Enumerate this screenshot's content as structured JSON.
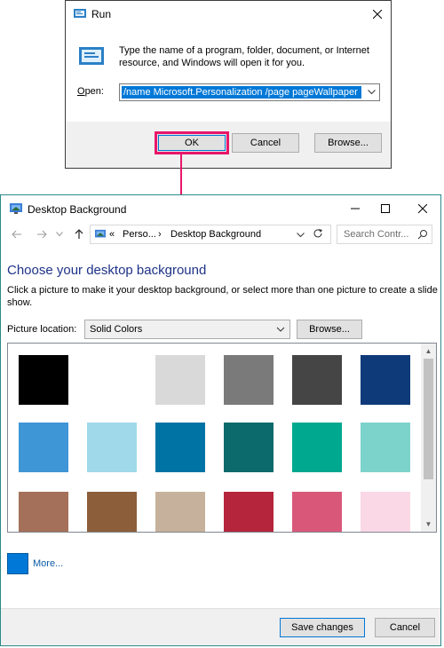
{
  "run_dialog": {
    "title": "Run",
    "description": "Type the name of a program, folder, document, or Internet resource, and Windows will open it for you.",
    "open_label": "Open:",
    "open_value": "/name Microsoft.Personalization /page pageWallpaper",
    "ok_label": "OK",
    "cancel_label": "Cancel",
    "browse_label": "Browse...",
    "highlight_color": "#e8176a"
  },
  "desktop_background": {
    "title": "Desktop Background",
    "breadcrumb": {
      "overflow": "«",
      "parent": "Perso...",
      "separator": "›",
      "current": "Desktop Background"
    },
    "search_placeholder": "Search Contr...",
    "heading": "Choose your desktop background",
    "subtext": "Click a picture to make it your desktop background, or select more than one picture to create a slide show.",
    "picture_location_label": "Picture location:",
    "picture_location_value": "Solid Colors",
    "browse_label": "Browse...",
    "swatches": [
      "#000000",
      "#ffffff",
      "#d9d9d9",
      "#7a7a7a",
      "#454545",
      "#0f3a7a",
      "#3f96d6",
      "#9fd9ea",
      "#0073a5",
      "#0d6a6c",
      "#00a88f",
      "#7cd3cc",
      "#a4705a",
      "#8c5f3a",
      "#c6b29c",
      "#b5253b",
      "#d9587a",
      "#fad8e6"
    ],
    "more_label": "More...",
    "more_color": "#0078d7",
    "save_label": "Save changes",
    "cancel_label": "Cancel"
  },
  "icons": [
    "run-app-icon",
    "close-icon",
    "run-big-icon",
    "chevron-down-icon",
    "arrow-down-icon",
    "control-panel-icon",
    "minimize-icon",
    "maximize-icon",
    "back-icon",
    "forward-icon",
    "recent-icon",
    "up-icon",
    "refresh-icon",
    "search-icon"
  ]
}
